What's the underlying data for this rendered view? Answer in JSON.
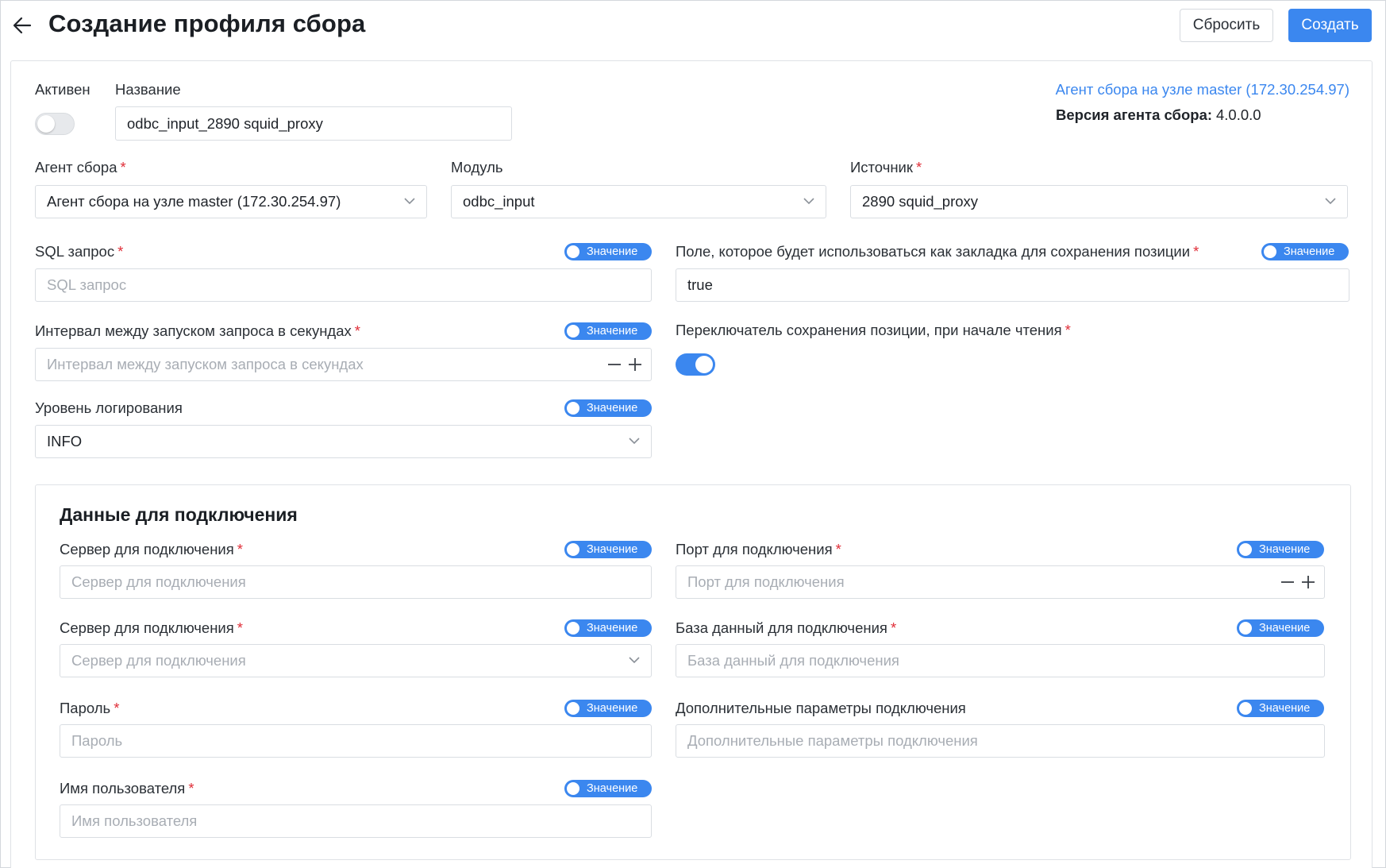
{
  "header": {
    "title": "Создание профиля сбора",
    "reset_label": "Сбросить",
    "create_label": "Создать"
  },
  "top": {
    "active_label": "Активен",
    "active_on": false,
    "name_label": "Название",
    "name_value": "odbc_input_2890 squid_proxy",
    "agent_link": "Агент сбора на узле master (172.30.254.97)",
    "version_label": "Версия агента сбора:",
    "version_value": "4.0.0.0"
  },
  "selects": {
    "agent": {
      "label": "Агент сбора",
      "required": true,
      "value": "Агент сбора на узле master (172.30.254.97)"
    },
    "module": {
      "label": "Модуль",
      "required": false,
      "value": "odbc_input"
    },
    "source": {
      "label": "Источник",
      "required": true,
      "value": "2890 squid_proxy"
    }
  },
  "mode_pill_label": "Значение",
  "fields": {
    "sql": {
      "label": "SQL запрос",
      "required": true,
      "placeholder": "SQL запрос"
    },
    "bookmark": {
      "label": "Поле, которое будет использоваться как закладка для сохранения позиции",
      "required": true,
      "value": "true"
    },
    "interval": {
      "label": "Интервал между запуском запроса в секундах",
      "required": true,
      "placeholder": "Интервал между запуском запроса в секундах"
    },
    "position_switch": {
      "label": "Переключатель сохранения позиции, при начале чтения",
      "required": true,
      "on": true
    },
    "log_level": {
      "label": "Уровень логирования",
      "required": false,
      "value": "INFO"
    }
  },
  "connection": {
    "title": "Данные для подключения",
    "server": {
      "label": "Сервер для подключения",
      "required": true,
      "placeholder": "Сервер для подключения"
    },
    "port": {
      "label": "Порт для подключения",
      "required": true,
      "placeholder": "Порт для подключения"
    },
    "server2": {
      "label": "Сервер для подключения",
      "required": true,
      "placeholder": "Сервер для подключения"
    },
    "database": {
      "label": "База данный для подключения",
      "required": true,
      "placeholder": "База данный для подключения"
    },
    "password": {
      "label": "Пароль",
      "required": true,
      "placeholder": "Пароль"
    },
    "extra_params": {
      "label": "Дополнительные параметры подключения",
      "required": false,
      "placeholder": "Дополнительные параметры подключения"
    },
    "username": {
      "label": "Имя пользователя",
      "required": true,
      "placeholder": "Имя пользователя"
    }
  },
  "colors": {
    "accent": "#3b87ef",
    "required": "#e0303a",
    "placeholder": "#a8adb4",
    "border": "#d9dde2"
  },
  "icons": {
    "back": "arrow-left-icon",
    "chevron": "chevron-down-icon",
    "minus": "minus-icon",
    "plus": "plus-icon"
  }
}
